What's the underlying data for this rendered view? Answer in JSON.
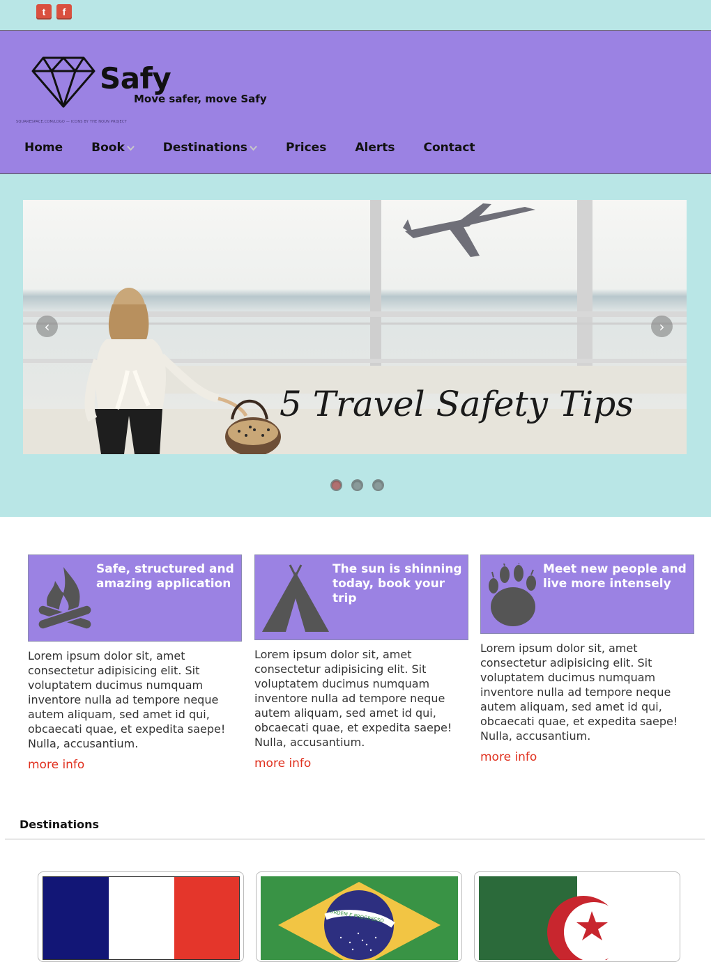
{
  "social": {
    "twitter_glyph": "t",
    "facebook_glyph": "f"
  },
  "header": {
    "brand": "Safy",
    "tagline": "Move safer, move Safy",
    "credit": "SQUARESPACE.COM/LOGO — ICONS BY THE NOUN PROJECT"
  },
  "nav": {
    "items": [
      {
        "label": "Home",
        "dropdown": false
      },
      {
        "label": "Book",
        "dropdown": true
      },
      {
        "label": "Destinations",
        "dropdown": true
      },
      {
        "label": "Prices",
        "dropdown": false
      },
      {
        "label": "Alerts",
        "dropdown": false
      },
      {
        "label": "Contact",
        "dropdown": false
      }
    ]
  },
  "slider": {
    "caption": "5 Travel Safety Tips",
    "prev_glyph": "‹",
    "next_glyph": "›",
    "slide_count": 3,
    "active_index": 0
  },
  "features": [
    {
      "title_line1": "Safe, structured and",
      "title_line2": "amazing application",
      "icon": "campfire-icon",
      "text": "Lorem ipsum dolor sit, amet consectetur adipisicing elit. Sit voluptatem ducimus numquam inventore nulla ad tempore neque autem aliquam, sed amet id qui, obcaecati quae, et expedita saepe! Nulla, accusantium.",
      "link": "more info"
    },
    {
      "title_line1": "The sun is shinning",
      "title_line2": "today, book your trip",
      "icon": "tent-icon",
      "text": "Lorem ipsum dolor sit, amet consectetur adipisicing elit. Sit voluptatem ducimus numquam inventore nulla ad tempore neque autem aliquam, sed amet id qui, obcaecati quae, et expedita saepe! Nulla, accusantium.",
      "link": "more info"
    },
    {
      "title_line1": "Meet new people and",
      "title_line2": "live more intensely",
      "icon": "paw-icon",
      "text": "Lorem ipsum dolor sit, amet consectetur adipisicing elit. Sit voluptatem ducimus numquam inventore nulla ad tempore neque autem aliquam, sed amet id qui, obcaecati quae, et expedita saepe! Nulla, accusantium.",
      "link": "more info"
    }
  ],
  "destinations": {
    "title": "Destinations",
    "flags": [
      "france-flag",
      "brazil-flag",
      "algeria-flag"
    ],
    "brazil_motto": "ORDEM E PROGRESSO"
  },
  "colors": {
    "topbar": "#b9e6e6",
    "header": "#9b82e3",
    "link": "#e0301e"
  }
}
